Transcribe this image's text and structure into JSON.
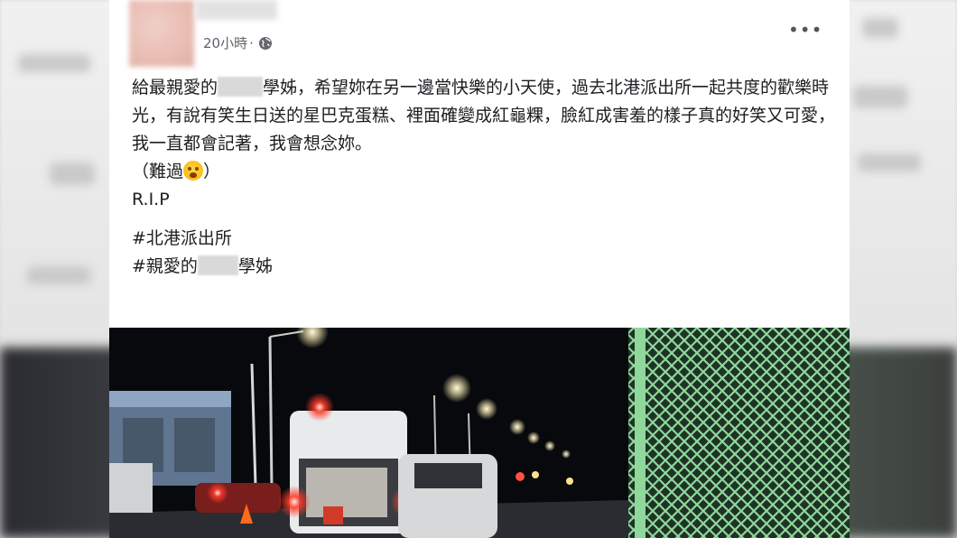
{
  "post": {
    "timestamp": "20小時",
    "separator": "·",
    "more_label": "•••",
    "line1_a": "給最親愛的",
    "line1_b": "學姊，希望妳在另一邊當快樂的小天使，過去北港派出所一起共度的歡樂時光，有說有笑生日送的星巴克蛋糕、裡面確變成紅龜粿，臉紅成害羞的樣子真的好笑又可愛，我一直都會記著，我會想念妳。",
    "line2_a": "（難過",
    "line2_b": "）",
    "line3": "R.I.P",
    "hashtag1": "#北港派出所",
    "hashtag2_a": "#親愛的",
    "hashtag2_b": "學姊"
  },
  "icons": {
    "privacy": "globe-icon",
    "emoji": "crying-face-emoji",
    "more": "more-options-icon"
  },
  "photo": {
    "subject": "night-street-police-car-photo"
  }
}
